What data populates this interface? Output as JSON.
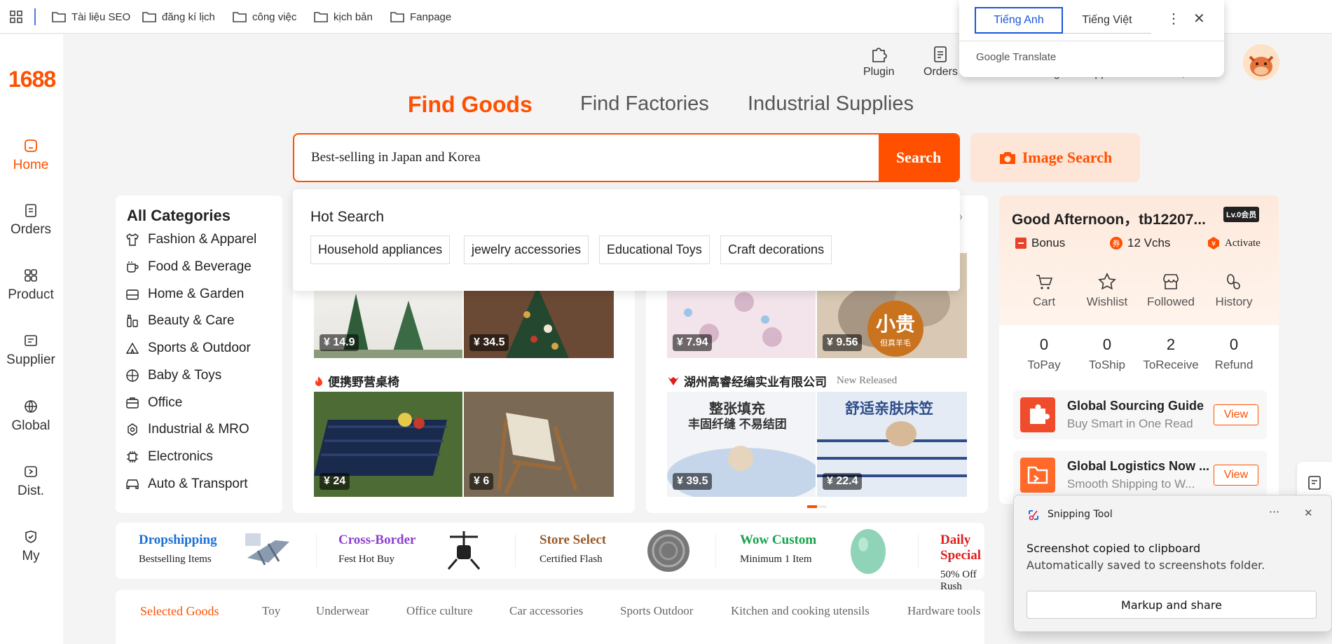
{
  "bookmarks": [
    {
      "label": "Tài liệu SEO"
    },
    {
      "label": "đăng kí lịch"
    },
    {
      "label": "công việc"
    },
    {
      "label": "kịch bản"
    },
    {
      "label": "Fanpage"
    }
  ],
  "brand": {
    "logo": "1688",
    "accent": "#ff5000"
  },
  "sidebar": {
    "items": [
      {
        "label": "Home",
        "icon": "home-icon"
      },
      {
        "label": "Orders",
        "icon": "orders-icon"
      },
      {
        "label": "Product",
        "icon": "product-icon"
      },
      {
        "label": "Supplier",
        "icon": "supplier-icon"
      },
      {
        "label": "Global",
        "icon": "globe-icon"
      },
      {
        "label": "Dist.",
        "icon": "distribution-icon"
      },
      {
        "label": "My",
        "icon": "my-icon"
      }
    ]
  },
  "header": {
    "plugin": "Plugin",
    "orders": "Orders",
    "partial_hidden": "Cart   Messages   Support Center   EN, USD"
  },
  "search": {
    "tabs": [
      "Find Goods",
      "Find Factories",
      "Industrial Supplies"
    ],
    "value": "Best-selling in Japan and Korea",
    "button": "Search",
    "image_search": "Image Search",
    "hot_title": "Hot Search",
    "hot_chips": [
      "Household appliances",
      "jewelry accessories",
      "Educational Toys",
      "Craft decorations"
    ]
  },
  "categories": {
    "title": "All Categories",
    "items": [
      {
        "label": "Fashion & Apparel",
        "icon": "shirt-icon"
      },
      {
        "label": "Food & Beverage",
        "icon": "cup-icon"
      },
      {
        "label": "Home & Garden",
        "icon": "home-garden-icon"
      },
      {
        "label": "Beauty & Care",
        "icon": "bottle-icon"
      },
      {
        "label": "Sports & Outdoor",
        "icon": "tent-icon"
      },
      {
        "label": "Baby & Toys",
        "icon": "ball-icon"
      },
      {
        "label": "Office",
        "icon": "briefcase-icon"
      },
      {
        "label": "Industrial & MRO",
        "icon": "gear-icon"
      },
      {
        "label": "Electronics",
        "icon": "chip-icon"
      },
      {
        "label": "Auto & Transport",
        "icon": "car-icon"
      }
    ]
  },
  "products": {
    "left_top": [
      "¥ 14.9",
      "¥ 34.5"
    ],
    "left_bottom_title": "便携野营桌椅",
    "left_bottom": [
      "¥ 24",
      "¥ 6"
    ],
    "right_top": [
      "¥ 7.94",
      "¥ 9.56"
    ],
    "right_top_badge": "小贵",
    "right_top_badge_sub": "但真羊毛",
    "right_bottom_title": "湖州高睿经编实业有限公司",
    "right_bottom_tag": "New Released",
    "right_bottom": [
      "¥ 39.5",
      "¥ 22.4"
    ],
    "right_bottom_caption1": "整张填充",
    "right_bottom_caption1b": "丰固纤缝 不易结团",
    "right_bottom_caption2": "舒适亲肤床笠"
  },
  "user": {
    "greeting": "Good Afternoon，tb12207...",
    "level": "Lv.0会员",
    "bonus": "Bonus",
    "vouchers": "12 Vchs",
    "activate": "Activate",
    "actions": [
      "Cart",
      "Wishlist",
      "Followed",
      "History"
    ],
    "counts": [
      {
        "n": "0",
        "label": "ToPay"
      },
      {
        "n": "0",
        "label": "ToShip"
      },
      {
        "n": "2",
        "label": "ToReceive"
      },
      {
        "n": "0",
        "label": "Refund"
      }
    ],
    "promos": [
      {
        "title": "Global Sourcing Guide",
        "sub": "Buy Smart in One Read",
        "button": "View"
      },
      {
        "title": "Global Logistics Now ...",
        "sub": "Smooth Shipping to W...",
        "button": "View"
      }
    ]
  },
  "strip": [
    {
      "title": "Dropshipping",
      "sub": "Bestselling Items",
      "color": "#1a6fd6"
    },
    {
      "title": "Cross-Border",
      "sub": "Fest Hot Buy",
      "color": "#8e3fd1"
    },
    {
      "title": "Store Select",
      "sub": "Certified Flash",
      "color": "#9a5b2a"
    },
    {
      "title": "Wow Custom",
      "sub": "Minimum 1 Item",
      "color": "#16a34a"
    },
    {
      "title": "Daily Special",
      "sub": "50% Off Rush",
      "color": "#e11d1d"
    }
  ],
  "bottom_tabs": [
    "Selected Goods",
    "Toy",
    "Underwear",
    "Office culture",
    "Car accessories",
    "Sports Outdoor",
    "Kitchen and cooking utensils",
    "Hardware tools"
  ],
  "google_translate": {
    "tabs": [
      "Tiếng Anh",
      "Tiếng Việt"
    ],
    "brand_a": "Google",
    "brand_b": "Translate"
  },
  "snipping": {
    "app": "Snipping Tool",
    "line1": "Screenshot copied to clipboard",
    "line2": "Automatically saved to screenshots folder.",
    "button": "Markup and share"
  }
}
